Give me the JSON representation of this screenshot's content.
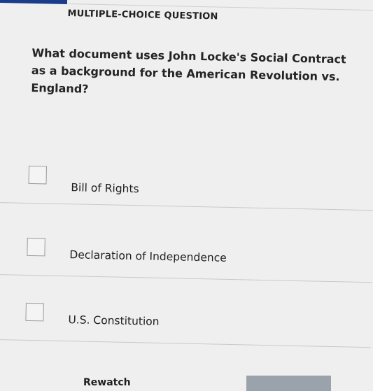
{
  "header": {
    "label": "MULTIPLE-CHOICE QUESTION"
  },
  "question": {
    "text": "What document uses John Locke's Social Contract as a background for the American Revolution vs. England?"
  },
  "choices": [
    {
      "label": "Bill of Rights",
      "checked": false
    },
    {
      "label": "Declaration of Independence",
      "checked": false
    },
    {
      "label": "U.S. Constitution",
      "checked": false
    }
  ],
  "footer": {
    "rewatch_label": "Rewatch"
  },
  "colors": {
    "accent_bar": "#1b3c8a",
    "page_background": "#efefef",
    "button_background": "#9aa3ab"
  }
}
